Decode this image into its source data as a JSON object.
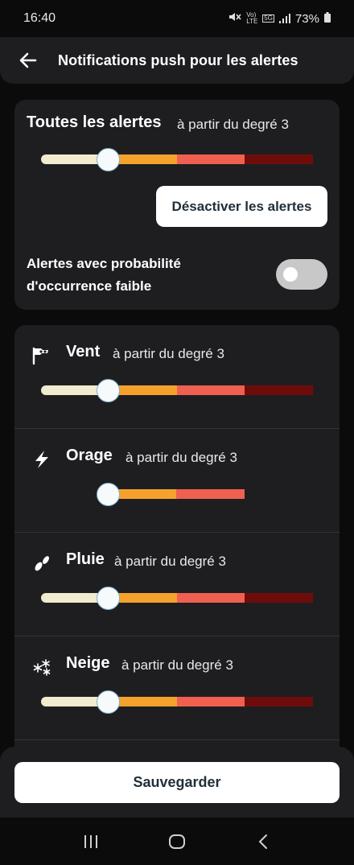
{
  "status_bar": {
    "time": "16:40",
    "volte": "Vo)",
    "lte": "LTE",
    "net": "5G",
    "battery": "73%"
  },
  "header": {
    "title": "Notifications push pour les alertes",
    "back_icon": "arrow-left-icon"
  },
  "all_alerts": {
    "title": "Toutes les alertes",
    "subtitle": "à partir du degré 3",
    "level": 2,
    "levels_total": 4,
    "deactivate_label": "Désactiver les alertes",
    "low_probability_label": "Alertes avec probabilité d'occurrence faible",
    "low_probability_enabled": false
  },
  "categories": [
    {
      "name": "Vent",
      "subtitle": "à partir du degré 3",
      "icon": "windsock-icon",
      "level": 2,
      "levels_total": 4
    },
    {
      "name": "Orage",
      "subtitle": "à partir du degré 3",
      "icon": "lightning-icon",
      "level": 2,
      "levels_total": 3
    },
    {
      "name": "Pluie",
      "subtitle": "à partir du degré 3",
      "icon": "raindrops-icon",
      "level": 2,
      "levels_total": 4
    },
    {
      "name": "Neige",
      "subtitle": "à partir du degré 3",
      "icon": "snowflakes-icon",
      "level": 2,
      "levels_total": 4
    }
  ],
  "save_label": "Sauvegarder",
  "colors": {
    "level_1": "#f1ebcf",
    "level_2": "#f5a22d",
    "level_3": "#f06051",
    "level_4": "#6e0c0a",
    "card_bg": "#1e1e21"
  }
}
